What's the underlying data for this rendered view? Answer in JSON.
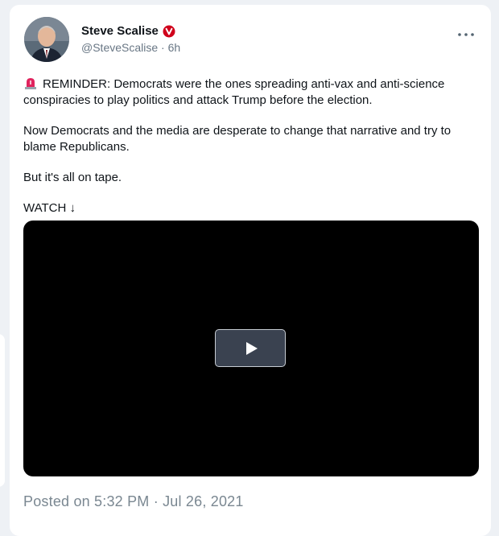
{
  "author": {
    "name": "Steve Scalise",
    "handle": "@SteveScalise",
    "separator": "·",
    "time_ago": "6h"
  },
  "icons": {
    "verified": "verified-badge-icon",
    "more": "more-options-icon",
    "siren": "rotating-light-icon",
    "play": "play-icon"
  },
  "colors": {
    "verified_badge": "#d0021b",
    "name": "#0f1419",
    "muted": "#687684"
  },
  "tweet": {
    "line1": "REMINDER: Democrats were the ones spreading anti-vax and anti-science conspiracies to play politics and attack Trump before the election.",
    "line2": "Now Democrats and the media are desperate to change that narrative and try to blame Republicans.",
    "line3": "But it's all on tape.",
    "line4": "WATCH ↓"
  },
  "footer": {
    "posted": "Posted on 5:32 PM · Jul 26, 2021"
  }
}
